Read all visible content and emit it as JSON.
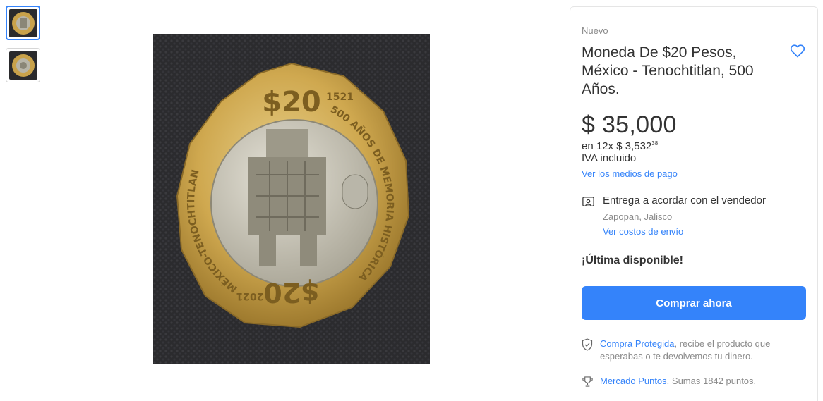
{
  "gallery": {
    "thumbnails": [
      {
        "alt": "thumbnail-1",
        "selected": true
      },
      {
        "alt": "thumbnail-2",
        "selected": false
      }
    ]
  },
  "product": {
    "condition": "Nuevo",
    "title": "Moneda De $20 Pesos, México - Tenochtitlan, 500 Años.",
    "price": "$ 35,000",
    "installments_prefix": "en 12x $ 3,532",
    "installments_cents": "38",
    "iva": "IVA incluido",
    "payments_link": "Ver los medios de pago"
  },
  "coin_inscriptions": {
    "denomination": "$20",
    "year_top": "1521",
    "text_right": "500 AÑOS DE MEMORIA HISTÓRICA",
    "text_left": "MÉXICO-TENOCHTITLAN",
    "year_bottom": "2021",
    "denomination_bottom": "$20"
  },
  "delivery": {
    "text": "Entrega a acordar con el vendedor",
    "location": "Zapopan, Jalisco",
    "shipping_link": "Ver costos de envío"
  },
  "stock": "¡Última disponible!",
  "buy_button": "Comprar ahora",
  "protection": {
    "link": "Compra Protegida",
    "text": ", recibe el producto que esperabas o te devolvemos tu dinero."
  },
  "points": {
    "link": "Mercado Puntos",
    "text": ". Sumas 1842 puntos."
  },
  "colors": {
    "accent": "#3483fa",
    "text": "#333333",
    "muted": "#8a8a8a"
  }
}
